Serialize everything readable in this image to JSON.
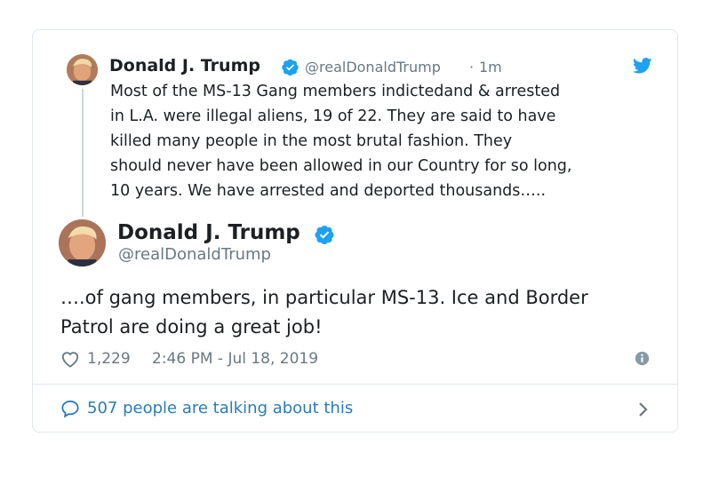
{
  "quoted_tweet": {
    "author_name": "Donald J. Trump",
    "handle": "@realDonaldTrump",
    "separator": "·",
    "time": "1m",
    "text_lines": [
      "Most of the MS-13 Gang members indictedand & arrested",
      "in L.A. were illegal aliens, 19 of 22. They are said to have",
      "killed many people in the most brutal fashion. They",
      "should never have been allowed in our Country for so long,",
      "10 years. We have arrested and deported thousands….."
    ]
  },
  "tweet": {
    "author_name": "Donald J. Trump",
    "handle": "@realDonaldTrump",
    "text_lines": [
      "….of gang members, in particular MS-13. Ice and Border",
      "Patrol are doing a great job!"
    ],
    "likes": "1,229",
    "timestamp": "2:46 PM - Jul 18, 2019"
  },
  "conversation": {
    "label": "507 people are talking about this"
  },
  "icons": {
    "verified": "verified-badge-icon",
    "bird": "twitter-bird-icon",
    "heart": "heart-icon",
    "info": "info-icon",
    "bubble": "comment-bubble-icon",
    "chevron": "chevron-right-icon"
  },
  "colors": {
    "accent": "#1da1f2",
    "link": "#2b7bb9",
    "muted": "#697882",
    "text": "#1c2022",
    "border": "#e1e8ed"
  }
}
